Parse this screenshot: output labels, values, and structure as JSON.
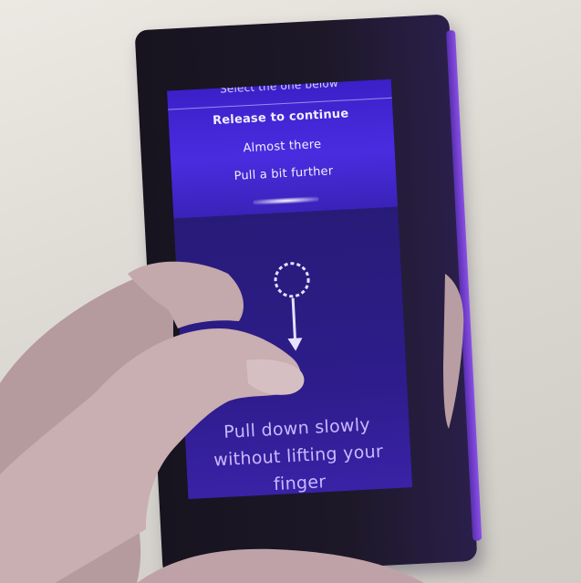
{
  "pulley_menu": {
    "top_hint": "Select the one below",
    "hint_release": "Release to continue",
    "hint_almost": "Almost there",
    "hint_pull": "Pull a bit further"
  },
  "instruction": {
    "line1": "Pull down slowly",
    "line2": "without lifting your",
    "line3": "finger"
  },
  "icons": {
    "gesture": "pull-down-gesture-icon"
  },
  "colors": {
    "pulley_bg": "#4a2ce0",
    "page_bg": "#2d1c8a",
    "instruction_text": "#c9b9ff"
  }
}
